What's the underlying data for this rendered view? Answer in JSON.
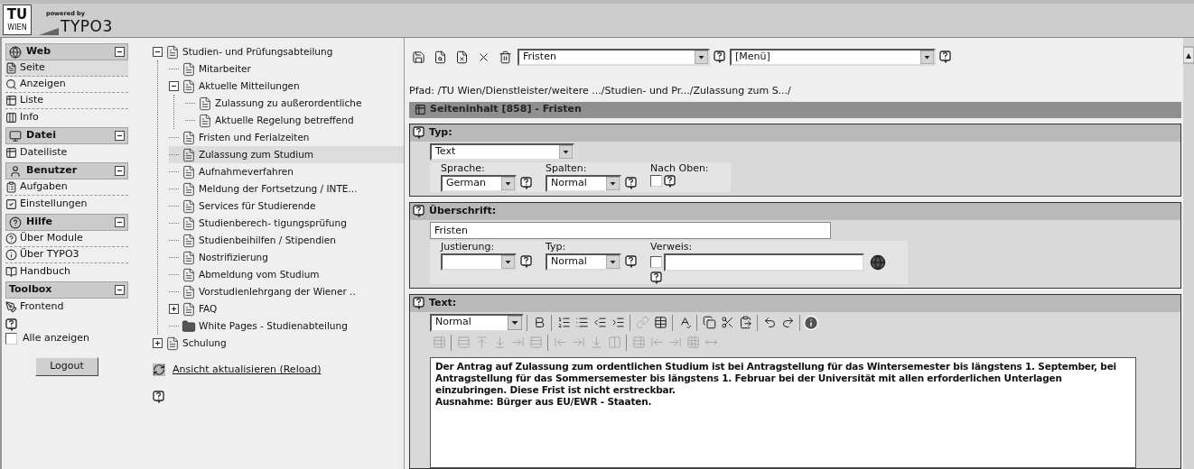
{
  "header": {
    "logo_main": "TU",
    "logo_sub": "WIEN",
    "powered_by": "powered by",
    "product": "TYPO3"
  },
  "modules": [
    {
      "title": "Web",
      "expanded": true,
      "items": [
        {
          "label": "Seite",
          "selected": true
        },
        {
          "label": "Anzeigen",
          "selected": false
        },
        {
          "label": "Liste",
          "selected": false
        },
        {
          "label": "Info",
          "selected": false
        }
      ]
    },
    {
      "title": "Datei",
      "expanded": true,
      "items": [
        {
          "label": "Dateiliste",
          "selected": false
        }
      ]
    },
    {
      "title": "Benutzer",
      "expanded": true,
      "items": [
        {
          "label": "Aufgaben",
          "selected": false
        },
        {
          "label": "Einstellungen",
          "selected": false
        }
      ]
    },
    {
      "title": "Hilfe",
      "expanded": true,
      "items": [
        {
          "label": "Über Module",
          "selected": false
        },
        {
          "label": "Über TYPO3",
          "selected": false
        },
        {
          "label": "Handbuch",
          "selected": false
        }
      ]
    },
    {
      "title": "Toolbox",
      "expanded": true,
      "items": [
        {
          "label": "Frontend",
          "selected": false
        }
      ]
    }
  ],
  "show_all": {
    "label": "Alle anzeigen",
    "checked": false
  },
  "logout": "Logout",
  "tree": [
    {
      "label": "Studien- und Prüfungsabteilung",
      "kind": "page",
      "selected": false,
      "expanded": true,
      "children": [
        {
          "label": "Mitarbeiter",
          "kind": "page",
          "selected": false
        },
        {
          "label": "Aktuelle Mitteilungen",
          "kind": "page",
          "selected": false,
          "expanded": true,
          "children": [
            {
              "label": "Zulassung zu außerordentliche",
              "kind": "page",
              "selected": false
            },
            {
              "label": "Aktuelle Regelung betreffend",
              "kind": "page",
              "selected": false
            }
          ]
        },
        {
          "label": "Fristen und Ferialzeiten",
          "kind": "page",
          "selected": false
        },
        {
          "label": "Zulassung zum Studium",
          "kind": "page",
          "selected": true
        },
        {
          "label": "Aufnahmeverfahren",
          "kind": "page",
          "selected": false
        },
        {
          "label": "Meldung der Fortsetzung / INTE...",
          "kind": "page",
          "selected": false
        },
        {
          "label": "Services für Studierende",
          "kind": "page",
          "selected": false
        },
        {
          "label": "Studienberech- tigungsprüfung",
          "kind": "page",
          "selected": false
        },
        {
          "label": "Studienbeihilfen / Stipendien",
          "kind": "page",
          "selected": false
        },
        {
          "label": "Nostrifizierung",
          "kind": "page",
          "selected": false
        },
        {
          "label": "Abmeldung vom Studium",
          "kind": "page",
          "selected": false
        },
        {
          "label": "Vorstudienlehrgang der Wiener ..",
          "kind": "page",
          "selected": false
        },
        {
          "label": "FAQ",
          "kind": "page",
          "selected": false,
          "expanded": false
        },
        {
          "label": "White Pages - Studienabteilung",
          "kind": "folder",
          "selected": false
        }
      ]
    },
    {
      "label": "Schulung",
      "kind": "page",
      "selected": false,
      "expanded": false
    }
  ],
  "reload_link": "Ansicht aktualisieren (Reload)",
  "doc_toolbar": {
    "record_select": "Fristen",
    "menu_select": "[Menü]"
  },
  "path": "Pfad: /TU Wien/Dienstleister/weitere .../Studien- und Pr.../Zulassung zum S.../",
  "section_title": "Seiteninhalt [858] - Fristen",
  "panels": [
    {
      "kind": "type",
      "title": "Typ:",
      "select": "Text",
      "fields": [
        {
          "kind": "select",
          "label": "Sprache:",
          "value": "German"
        },
        {
          "kind": "select",
          "label": "Spalten:",
          "value": "Normal"
        },
        {
          "kind": "checkbox",
          "label": "Nach Oben:",
          "checked": false
        }
      ]
    },
    {
      "kind": "header",
      "title": "Überschrift:",
      "value": "Fristen",
      "fields": [
        {
          "kind": "select",
          "label": "Justierung:"
        },
        {
          "kind": "select",
          "label": "Typ:",
          "value": "Normal"
        },
        {
          "kind": "link",
          "label": "Verweis:",
          "checked": false
        }
      ]
    },
    {
      "kind": "text",
      "title": "Text:",
      "style_select": "Normal",
      "table_tools_disabled": true,
      "paragraphs": [
        "Der Antrag auf Zulassung zum ordentlichen Studium ist bei Antragstellung für das Wintersemester bis längstens 1. September, bei Antragstellung für das Sommersemester bis längstens 1. Februar bei der Universität mit allen erforderlichen Unterlagen einzubringen. Diese Frist ist nicht erstreckbar.",
        "Ausnahme: Bürger aus EU/EWR - Staaten."
      ]
    }
  ]
}
